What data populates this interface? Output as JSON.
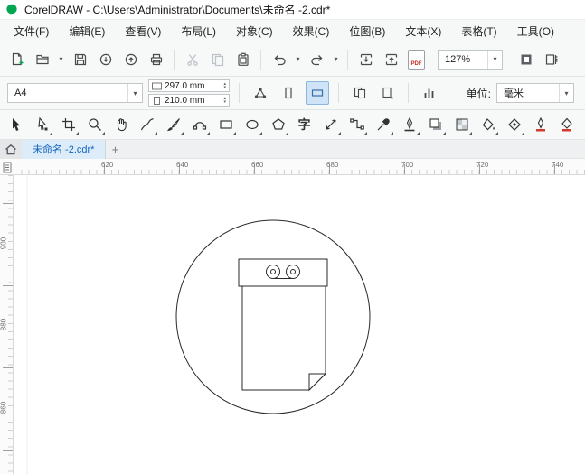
{
  "window": {
    "title": "CorelDRAW - C:\\Users\\Administrator\\Documents\\未命名 -2.cdr*"
  },
  "icons": {
    "caret_down": "▾",
    "spin_up": "▴",
    "spin_down": "▾"
  },
  "menu_bar": {
    "items": [
      "文件(F)",
      "编辑(E)",
      "查看(V)",
      "布局(L)",
      "对象(C)",
      "效果(C)",
      "位图(B)",
      "文本(X)",
      "表格(T)",
      "工具(O)"
    ]
  },
  "standard_toolbar": {
    "zoom_value": "127%",
    "pdf_label": "PDF"
  },
  "property_bar": {
    "page_preset": "A4",
    "page_width": "297.0 mm",
    "page_height": "210.0 mm",
    "units_label": "单位:",
    "units_value": "毫米"
  },
  "toolbox": {
    "text_tool_glyph": "字"
  },
  "document_tabs": {
    "active": "未命名 -2.cdr*",
    "new_tab": "+"
  },
  "rulers": {
    "h": [
      "620",
      "640",
      "660",
      "680",
      "700",
      "720",
      "740"
    ],
    "v": [
      "900",
      "880",
      "860"
    ]
  }
}
